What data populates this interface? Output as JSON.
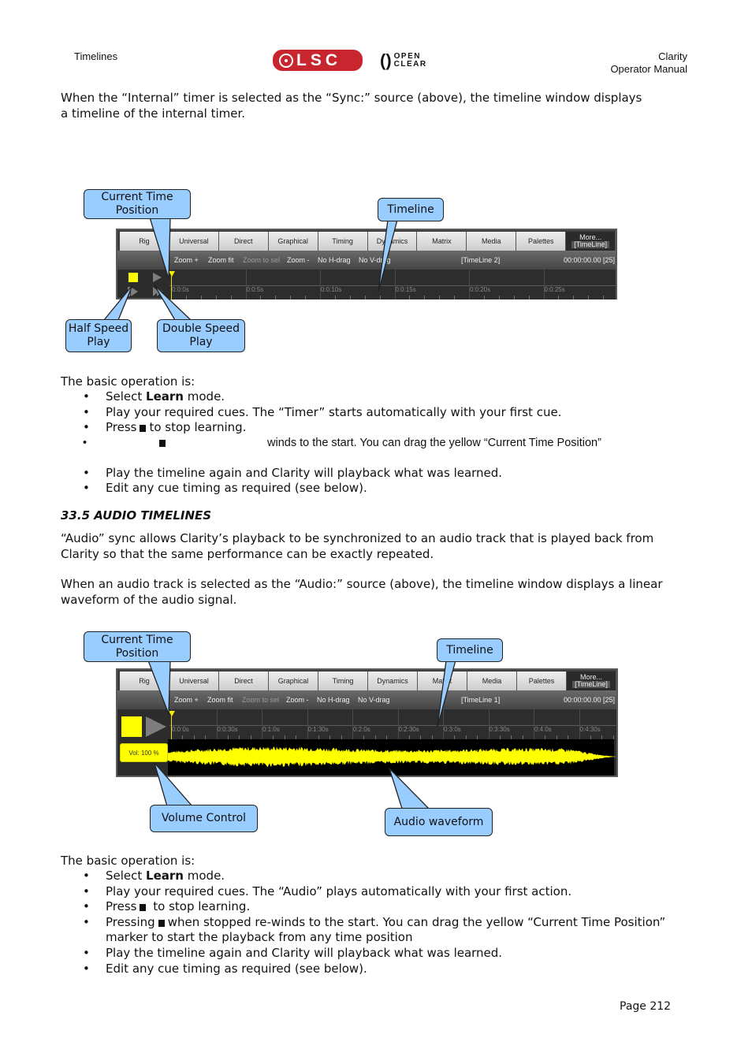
{
  "header": {
    "section": "Timelines",
    "product": "Clarity",
    "doc": "Operator Manual",
    "logo_lsc": "LSC",
    "logo_openclear_line1": "OPEN",
    "logo_openclear_line2": "CLEAR",
    "brand_color": "#c8262e"
  },
  "intro": {
    "text": "When the “Internal” timer is selected as the “Sync:” source (above), the timeline window displays a timeline of the internal timer."
  },
  "figure1": {
    "tabs": [
      "Rig",
      "Universal",
      "Direct",
      "Graphical",
      "Timing",
      "Dynamics",
      "Matrix",
      "Media",
      "Palettes"
    ],
    "more_tab": {
      "line1": "More...",
      "line2": "[TimeLine]"
    },
    "toolbar": {
      "zoom_in": "Zoom +",
      "zoom_fit": "Zoom fit",
      "zoom_to_sel": "Zoom to sel",
      "zoom_out": "Zoom -",
      "h_drag": "No H-drag",
      "v_drag": "No V-drag",
      "timeline_name": "[TimeLine 2]",
      "timecode": "00:00:00.00 [25]"
    },
    "ticks": [
      "0:0:0s",
      "0:0:5s",
      "0:0:10s",
      "0:0:15s",
      "0:0:20s",
      "0:0:25s"
    ],
    "callouts": {
      "current_time": "Current Time Position",
      "timeline": "Timeline",
      "half_speed": "Half Speed Play",
      "double_speed": "Double Speed Play"
    }
  },
  "ops1": {
    "intro": "The basic operation is:",
    "items": {
      "select_pre": "Select ",
      "select_bold": "Learn",
      "select_post": " mode.",
      "play_cues": "Play your required cues. The “Timer” starts automatically with your first cue.",
      "press_pre": "Press",
      "press_post": "to stop learning.",
      "rewind_tail": "winds to the start. You can drag the yellow “Current Time Position”",
      "play_again": "Play the timeline again and Clarity will playback what was learned.",
      "edit": "Edit any cue timing as required (see below)."
    }
  },
  "section": {
    "heading": "33.5 AUDIO TIMELINES",
    "para1": "“Audio” sync allows Clarity’s playback to be synchronized to an audio track that is played back from Clarity so that the same performance can be exactly repeated.",
    "para2": "When an audio track is selected as the “Audio:” source (above), the timeline window displays a linear waveform of the audio signal."
  },
  "figure2": {
    "tabs": [
      "Rig",
      "Universal",
      "Direct",
      "Graphical",
      "Timing",
      "Dynamics",
      "Matrix",
      "Media",
      "Palettes"
    ],
    "more_tab": {
      "line1": "More...",
      "line2": "[TimeLine]"
    },
    "toolbar": {
      "zoom_in": "Zoom +",
      "zoom_fit": "Zoom fit",
      "zoom_to_sel": "Zoom to sel",
      "zoom_out": "Zoom -",
      "h_drag": "No H-drag",
      "v_drag": "No V-drag",
      "timeline_name": "[TimeLine 1]",
      "timecode": "00:00:00.00 [25]"
    },
    "ticks": [
      "0:0:0s",
      "0:0:30s",
      "0:1:0s",
      "0:1:30s",
      "0:2:0s",
      "0:2:30s",
      "0:3:0s",
      "0:3:30s",
      "0:4:0s",
      "0:4:30s"
    ],
    "volume": "Vol: 100 %",
    "waveform_color": "#ffff00",
    "callouts": {
      "current_time": "Current Time Position",
      "timeline": "Timeline",
      "volume": "Volume Control",
      "waveform": "Audio waveform"
    }
  },
  "ops2": {
    "intro": "The basic operation is:",
    "items": {
      "select_pre": "Select ",
      "select_bold": "Learn",
      "select_post": " mode.",
      "play_cues": "Play your required cues. The “Audio” plays automatically with your first action.",
      "press_pre": "Press",
      "press_post": "to stop learning.",
      "pressing_pre": "Pressing",
      "pressing_post": "when stopped re-winds to the start. You can drag the yellow “Current Time Position” marker to start the playback from any time position",
      "play_again": "Play the timeline again and Clarity will playback what was learned.",
      "edit": "Edit any cue timing as required (see below)."
    }
  },
  "footer": {
    "page": "Page 212"
  }
}
